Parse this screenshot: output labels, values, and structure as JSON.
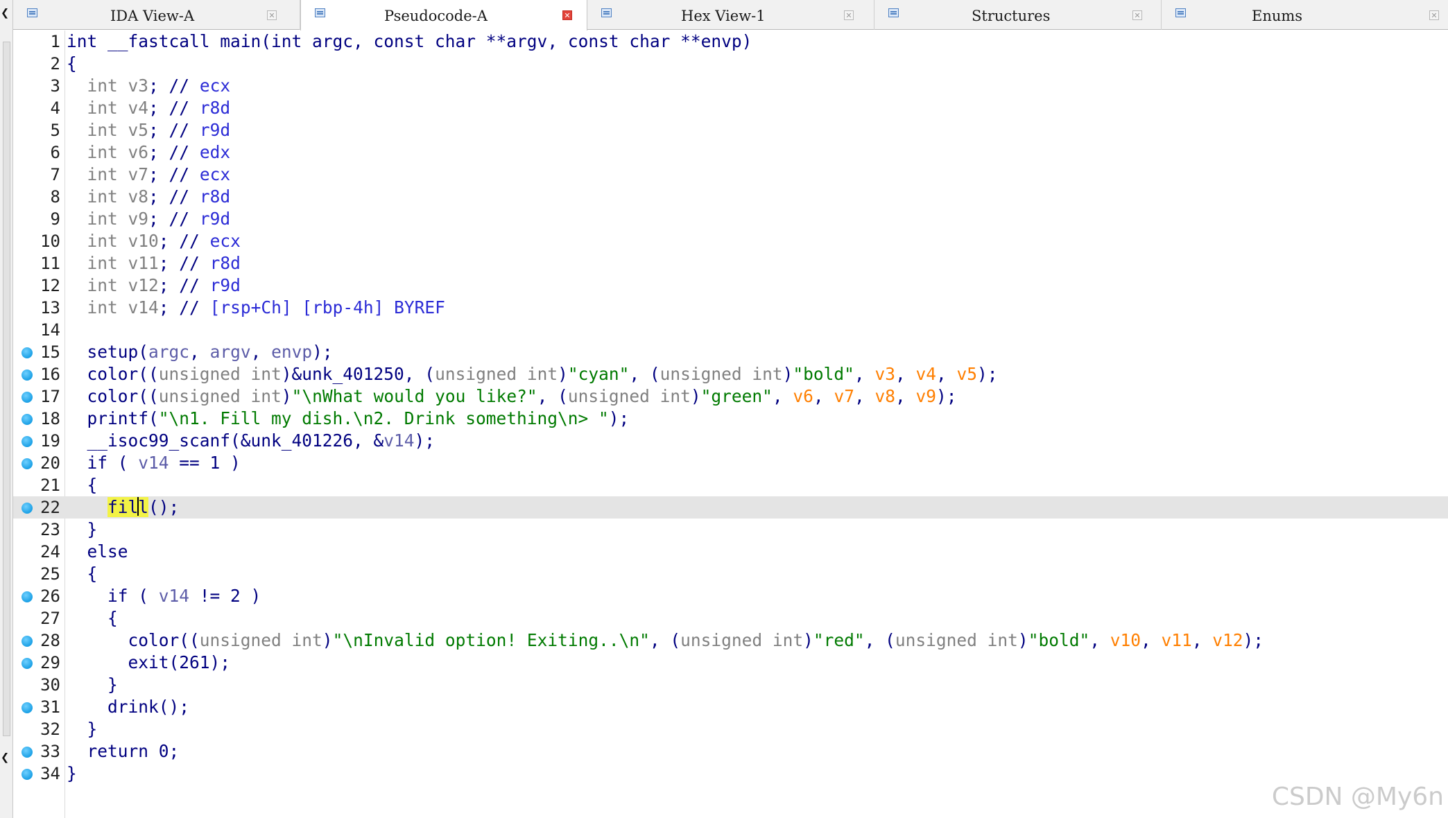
{
  "tabs": [
    {
      "label": "IDA View-A",
      "icon": "ida-view-icon",
      "active": false
    },
    {
      "label": "Pseudocode-A",
      "icon": "pseudocode-icon",
      "active": true
    },
    {
      "label": "Hex View-1",
      "icon": "hex-view-icon",
      "active": false
    },
    {
      "label": "Structures",
      "icon": "structures-icon",
      "active": false
    },
    {
      "label": "Enums",
      "icon": "enums-icon",
      "active": false
    }
  ],
  "tab_close_glyph": "✕",
  "left_strip_marks": [
    "❮",
    "❮"
  ],
  "colors": {
    "keyword": "#000080",
    "string": "#007a00",
    "register_var": "#ff7f00",
    "comment": "#2b2bd6",
    "breakpoint_dot": "#1ba0e5",
    "highlight": "#f3f346"
  },
  "cursor": {
    "line": 22,
    "word": "fill"
  },
  "lines": [
    {
      "n": "1",
      "bp": false,
      "indent": "",
      "tokens": [
        [
          "k",
          "int __fastcall main(int "
        ],
        [
          "k",
          "argc"
        ],
        [
          "k",
          ", const char **"
        ],
        [
          "k",
          "argv"
        ],
        [
          "k",
          ", const char **"
        ],
        [
          "k",
          "envp"
        ],
        [
          "k",
          ")"
        ]
      ]
    },
    {
      "n": "2",
      "bp": false,
      "indent": "",
      "tokens": [
        [
          "k",
          "{"
        ]
      ]
    },
    {
      "n": "3",
      "bp": false,
      "indent": "  ",
      "tokens": [
        [
          "g",
          "int "
        ],
        [
          "g",
          "v3"
        ],
        [
          "k",
          "; // "
        ],
        [
          "c",
          "ecx"
        ]
      ]
    },
    {
      "n": "4",
      "bp": false,
      "indent": "  ",
      "tokens": [
        [
          "g",
          "int "
        ],
        [
          "g",
          "v4"
        ],
        [
          "k",
          "; // "
        ],
        [
          "c",
          "r8d"
        ]
      ]
    },
    {
      "n": "5",
      "bp": false,
      "indent": "  ",
      "tokens": [
        [
          "g",
          "int "
        ],
        [
          "g",
          "v5"
        ],
        [
          "k",
          "; // "
        ],
        [
          "c",
          "r9d"
        ]
      ]
    },
    {
      "n": "6",
      "bp": false,
      "indent": "  ",
      "tokens": [
        [
          "g",
          "int "
        ],
        [
          "g",
          "v6"
        ],
        [
          "k",
          "; // "
        ],
        [
          "c",
          "edx"
        ]
      ]
    },
    {
      "n": "7",
      "bp": false,
      "indent": "  ",
      "tokens": [
        [
          "g",
          "int "
        ],
        [
          "g",
          "v7"
        ],
        [
          "k",
          "; // "
        ],
        [
          "c",
          "ecx"
        ]
      ]
    },
    {
      "n": "8",
      "bp": false,
      "indent": "  ",
      "tokens": [
        [
          "g",
          "int "
        ],
        [
          "g",
          "v8"
        ],
        [
          "k",
          "; // "
        ],
        [
          "c",
          "r8d"
        ]
      ]
    },
    {
      "n": "9",
      "bp": false,
      "indent": "  ",
      "tokens": [
        [
          "g",
          "int "
        ],
        [
          "g",
          "v9"
        ],
        [
          "k",
          "; // "
        ],
        [
          "c",
          "r9d"
        ]
      ]
    },
    {
      "n": "10",
      "bp": false,
      "indent": "  ",
      "tokens": [
        [
          "g",
          "int "
        ],
        [
          "g",
          "v10"
        ],
        [
          "k",
          "; // "
        ],
        [
          "c",
          "ecx"
        ]
      ]
    },
    {
      "n": "11",
      "bp": false,
      "indent": "  ",
      "tokens": [
        [
          "g",
          "int "
        ],
        [
          "g",
          "v11"
        ],
        [
          "k",
          "; // "
        ],
        [
          "c",
          "r8d"
        ]
      ]
    },
    {
      "n": "12",
      "bp": false,
      "indent": "  ",
      "tokens": [
        [
          "g",
          "int "
        ],
        [
          "g",
          "v12"
        ],
        [
          "k",
          "; // "
        ],
        [
          "c",
          "r9d"
        ]
      ]
    },
    {
      "n": "13",
      "bp": false,
      "indent": "  ",
      "tokens": [
        [
          "g",
          "int "
        ],
        [
          "g",
          "v14"
        ],
        [
          "k",
          "; // "
        ],
        [
          "c",
          "[rsp+Ch] [rbp-4h] BYREF"
        ]
      ]
    },
    {
      "n": "14",
      "bp": false,
      "indent": "",
      "tokens": []
    },
    {
      "n": "15",
      "bp": true,
      "indent": "  ",
      "tokens": [
        [
          "k",
          "setup("
        ],
        [
          "v",
          "argc"
        ],
        [
          "k",
          ", "
        ],
        [
          "v",
          "argv"
        ],
        [
          "k",
          ", "
        ],
        [
          "v",
          "envp"
        ],
        [
          "k",
          ");"
        ]
      ]
    },
    {
      "n": "16",
      "bp": true,
      "indent": "  ",
      "tokens": [
        [
          "k",
          "color(("
        ],
        [
          "g",
          "unsigned int"
        ],
        [
          "k",
          ")&unk_401250, ("
        ],
        [
          "g",
          "unsigned int"
        ],
        [
          "k",
          ")"
        ],
        [
          "s",
          "\"cyan\""
        ],
        [
          "k",
          ", ("
        ],
        [
          "g",
          "unsigned int"
        ],
        [
          "k",
          ")"
        ],
        [
          "s",
          "\"bold\""
        ],
        [
          "k",
          ", "
        ],
        [
          "o",
          "v3"
        ],
        [
          "k",
          ", "
        ],
        [
          "o",
          "v4"
        ],
        [
          "k",
          ", "
        ],
        [
          "o",
          "v5"
        ],
        [
          "k",
          ");"
        ]
      ]
    },
    {
      "n": "17",
      "bp": true,
      "indent": "  ",
      "tokens": [
        [
          "k",
          "color(("
        ],
        [
          "g",
          "unsigned int"
        ],
        [
          "k",
          ")"
        ],
        [
          "s",
          "\"\\nWhat would you like?\""
        ],
        [
          "k",
          ", ("
        ],
        [
          "g",
          "unsigned int"
        ],
        [
          "k",
          ")"
        ],
        [
          "s",
          "\"green\""
        ],
        [
          "k",
          ", "
        ],
        [
          "o",
          "v6"
        ],
        [
          "k",
          ", "
        ],
        [
          "o",
          "v7"
        ],
        [
          "k",
          ", "
        ],
        [
          "o",
          "v8"
        ],
        [
          "k",
          ", "
        ],
        [
          "o",
          "v9"
        ],
        [
          "k",
          ");"
        ]
      ]
    },
    {
      "n": "18",
      "bp": true,
      "indent": "  ",
      "tokens": [
        [
          "k",
          "printf("
        ],
        [
          "s",
          "\"\\n1. Fill my dish.\\n2. Drink something\\n> \""
        ],
        [
          "k",
          ");"
        ]
      ]
    },
    {
      "n": "19",
      "bp": true,
      "indent": "  ",
      "tokens": [
        [
          "k",
          "__isoc99_scanf(&unk_401226, &"
        ],
        [
          "v",
          "v14"
        ],
        [
          "k",
          ");"
        ]
      ]
    },
    {
      "n": "20",
      "bp": true,
      "indent": "  ",
      "tokens": [
        [
          "k",
          "if ( "
        ],
        [
          "v",
          "v14"
        ],
        [
          "k",
          " == 1 )"
        ]
      ]
    },
    {
      "n": "21",
      "bp": false,
      "indent": "  ",
      "tokens": [
        [
          "k",
          "{"
        ]
      ]
    },
    {
      "n": "22",
      "bp": true,
      "indent": "    ",
      "current": true,
      "tokens": [
        [
          "hl",
          "fill"
        ],
        [
          "k",
          "();"
        ]
      ]
    },
    {
      "n": "23",
      "bp": false,
      "indent": "  ",
      "tokens": [
        [
          "k",
          "}"
        ]
      ]
    },
    {
      "n": "24",
      "bp": false,
      "indent": "  ",
      "tokens": [
        [
          "k",
          "else"
        ]
      ]
    },
    {
      "n": "25",
      "bp": false,
      "indent": "  ",
      "tokens": [
        [
          "k",
          "{"
        ]
      ]
    },
    {
      "n": "26",
      "bp": true,
      "indent": "    ",
      "tokens": [
        [
          "k",
          "if ( "
        ],
        [
          "v",
          "v14"
        ],
        [
          "k",
          " != 2 )"
        ]
      ]
    },
    {
      "n": "27",
      "bp": false,
      "indent": "    ",
      "tokens": [
        [
          "k",
          "{"
        ]
      ]
    },
    {
      "n": "28",
      "bp": true,
      "indent": "      ",
      "tokens": [
        [
          "k",
          "color(("
        ],
        [
          "g",
          "unsigned int"
        ],
        [
          "k",
          ")"
        ],
        [
          "s",
          "\"\\nInvalid option! Exiting..\\n\""
        ],
        [
          "k",
          ", ("
        ],
        [
          "g",
          "unsigned int"
        ],
        [
          "k",
          ")"
        ],
        [
          "s",
          "\"red\""
        ],
        [
          "k",
          ", ("
        ],
        [
          "g",
          "unsigned int"
        ],
        [
          "k",
          ")"
        ],
        [
          "s",
          "\"bold\""
        ],
        [
          "k",
          ", "
        ],
        [
          "o",
          "v10"
        ],
        [
          "k",
          ", "
        ],
        [
          "o",
          "v11"
        ],
        [
          "k",
          ", "
        ],
        [
          "o",
          "v12"
        ],
        [
          "k",
          ");"
        ]
      ]
    },
    {
      "n": "29",
      "bp": true,
      "indent": "      ",
      "tokens": [
        [
          "k",
          "exit(261);"
        ]
      ]
    },
    {
      "n": "30",
      "bp": false,
      "indent": "    ",
      "tokens": [
        [
          "k",
          "}"
        ]
      ]
    },
    {
      "n": "31",
      "bp": true,
      "indent": "    ",
      "tokens": [
        [
          "k",
          "drink();"
        ]
      ]
    },
    {
      "n": "32",
      "bp": false,
      "indent": "  ",
      "tokens": [
        [
          "k",
          "}"
        ]
      ]
    },
    {
      "n": "33",
      "bp": true,
      "indent": "  ",
      "tokens": [
        [
          "k",
          "return 0;"
        ]
      ]
    },
    {
      "n": "34",
      "bp": true,
      "indent": "",
      "tokens": [
        [
          "k",
          "}"
        ]
      ]
    }
  ],
  "watermark": "CSDN @My6n"
}
